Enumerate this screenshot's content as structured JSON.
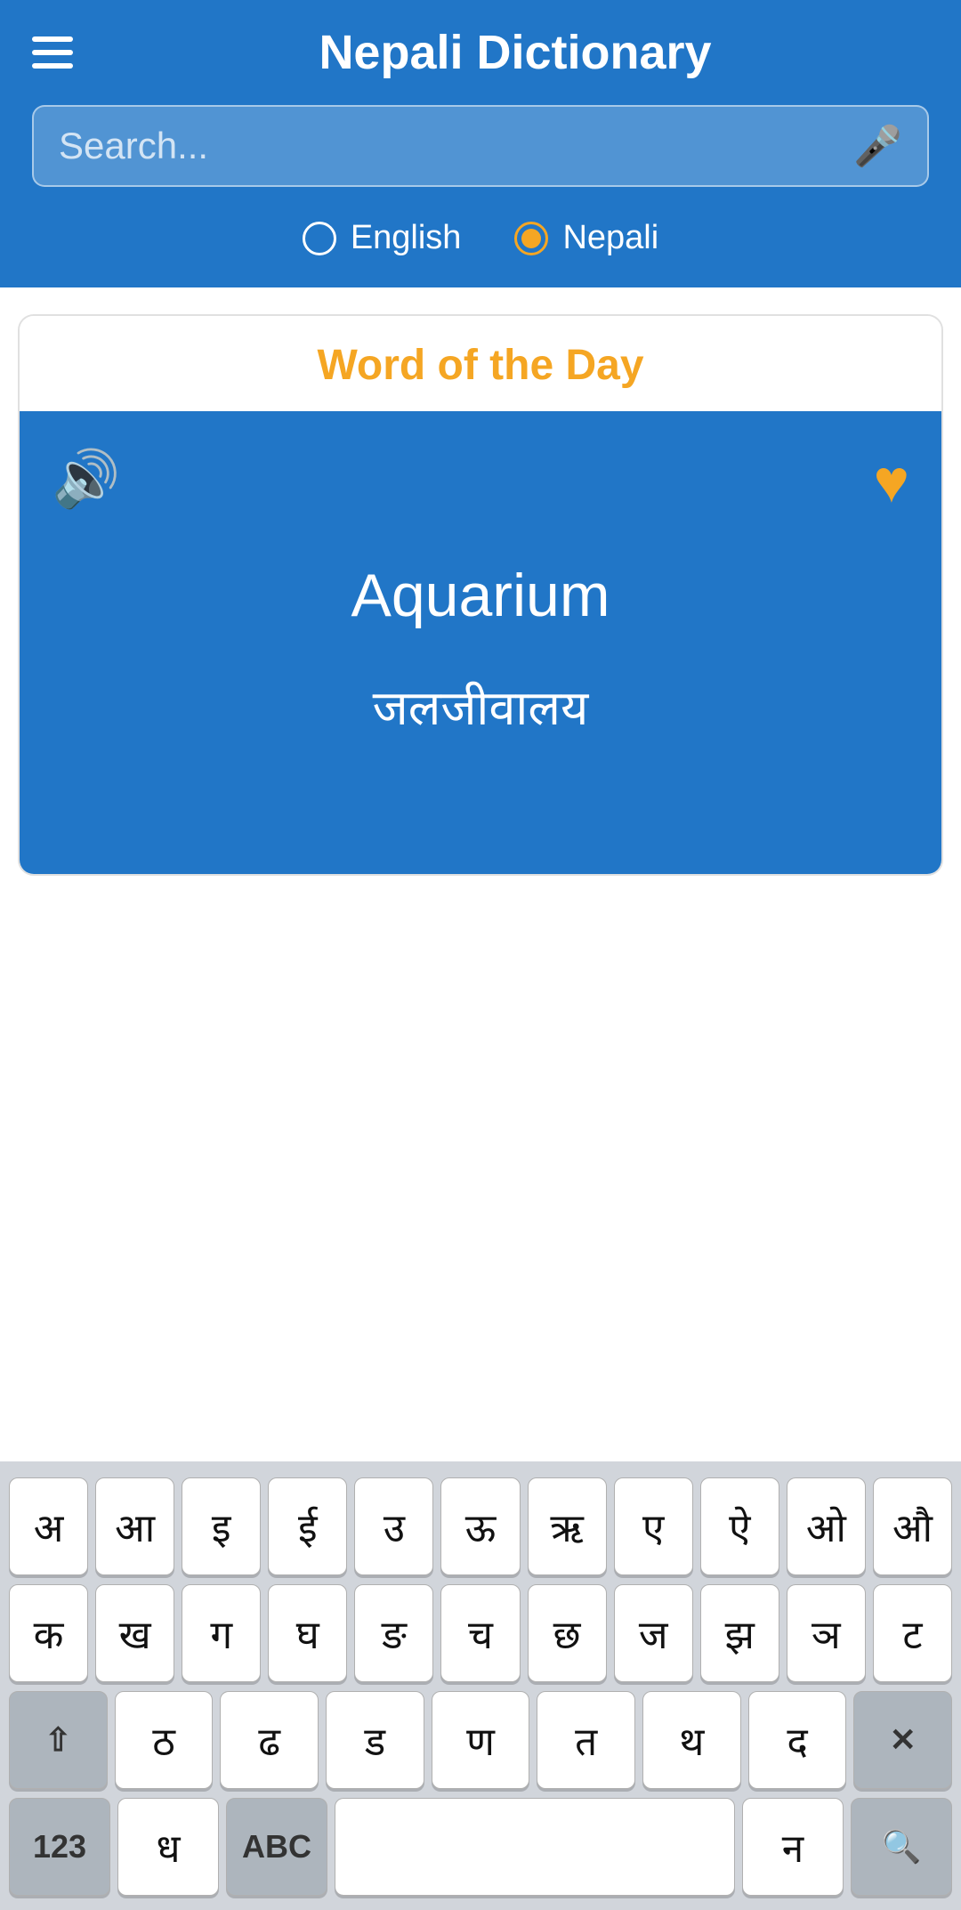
{
  "header": {
    "title": "Nepali Dictionary",
    "search_placeholder": "Search..."
  },
  "language_toggle": {
    "option1_label": "English",
    "option2_label": "Nepali",
    "selected": "nepali"
  },
  "word_of_day": {
    "section_title": "Word of the Day",
    "english_word": "Aquarium",
    "nepali_word": "जलजीवालय"
  },
  "keyboard": {
    "row1": [
      "अ",
      "आ",
      "इ",
      "ई",
      "उ",
      "ऊ",
      "ऋ",
      "ए",
      "ऐ",
      "ओ",
      "औ"
    ],
    "row2": [
      "क",
      "ख",
      "ग",
      "घ",
      "ङ",
      "च",
      "छ",
      "ज",
      "झ",
      "ञ",
      "ट"
    ],
    "row3_special_left": "⇧",
    "row3": [
      "ठ",
      "ढ",
      "ड",
      "ण",
      "त",
      "थ",
      "द"
    ],
    "row3_backspace": "×",
    "row4_123": "123",
    "row4_dh": "ध",
    "row4_abc": "ABC",
    "row4_space": "",
    "row4_na": "न",
    "row4_search": "🔍"
  },
  "icons": {
    "hamburger": "☰",
    "mic": "🎤",
    "speaker": "🔊",
    "heart": "♥",
    "search": "🔍"
  }
}
